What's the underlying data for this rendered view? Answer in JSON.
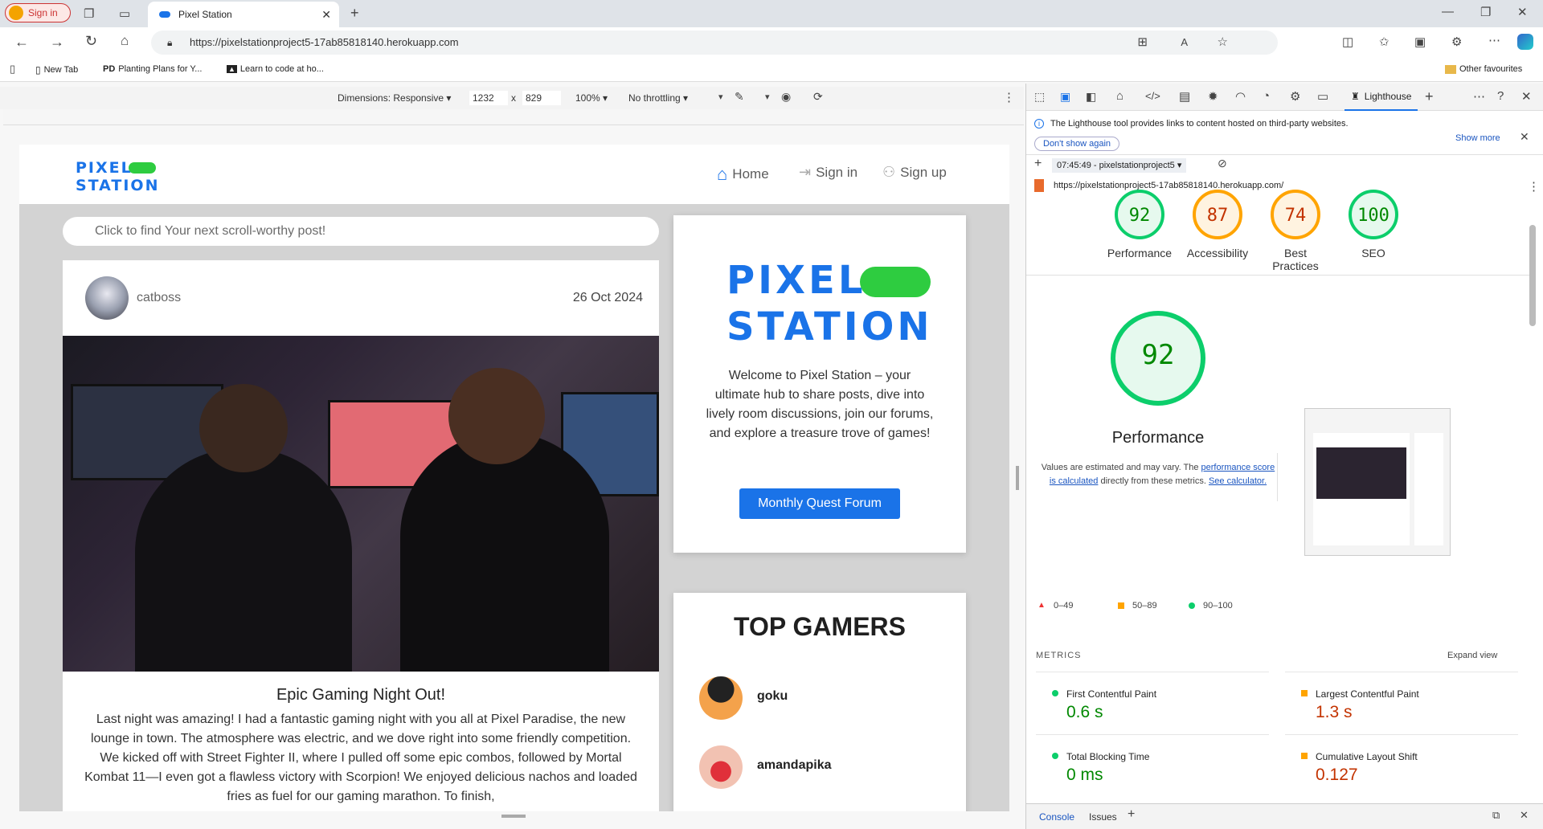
{
  "browser": {
    "profile_label": "Sign in",
    "tab_title": "Pixel Station",
    "url": "https://pixelstationproject5-17ab85818140.herokuapp.com",
    "bookmarks": [
      "New Tab",
      "Planting Plans for Y...",
      "Learn to code at ho..."
    ],
    "other_favourites": "Other favourites"
  },
  "device_toolbar": {
    "dimensions": "Dimensions: Responsive",
    "width": "1232",
    "height": "829",
    "zoom": "100%",
    "throttling": "No throttling",
    "times": "x"
  },
  "site": {
    "logo_line1": "PIXEL",
    "logo_line2": "STATION",
    "nav": [
      "Home",
      "Sign in",
      "Sign up"
    ],
    "search_placeholder": "Click to find Your next scroll-worthy post!",
    "post": {
      "author": "catboss",
      "date": "26 Oct 2024",
      "title": "Epic Gaming Night Out!",
      "body": "Last night was amazing! I had a fantastic gaming night with you all at Pixel Paradise, the new lounge in town. The atmosphere was electric, and we dove right into some friendly competition. We kicked off with Street Fighter II, where I pulled off some epic combos, followed by Mortal Kombat 11—I even got a flawless victory with Scorpion! We enjoyed delicious nachos and loaded fries as fuel for our gaming marathon. To finish,"
    },
    "welcome": {
      "logo_line1": "PIXEL",
      "logo_line2": "STATION",
      "text": "Welcome to Pixel Station – your ultimate hub to share posts, dive into lively room discussions, join our forums, and explore a treasure trove of games!",
      "button": "Monthly Quest Forum"
    },
    "top_gamers": {
      "heading": "TOP GAMERS",
      "users": [
        "goku",
        "amandapika"
      ]
    }
  },
  "lighthouse": {
    "tab_label": "Lighthouse",
    "notice": "The Lighthouse tool provides links to content hosted on third-party websites.",
    "dont_show": "Don't show again",
    "show_more": "Show more",
    "report_select": "07:45:49 - pixelstationproject5",
    "report_url": "https://pixelstationproject5-17ab85818140.herokuapp.com/",
    "scores": [
      {
        "value": "92",
        "label": "Performance",
        "color": "#0cce6b"
      },
      {
        "value": "87",
        "label": "Accessibility",
        "color": "#ffa400"
      },
      {
        "value": "74",
        "label": "Best Practices",
        "color": "#ffa400"
      },
      {
        "value": "100",
        "label": "SEO",
        "color": "#0cce6b"
      }
    ],
    "perf_score": "92",
    "perf_label": "Performance",
    "perf_note_1": "Values are estimated and may vary. The",
    "perf_link": "performance score is calculated",
    "perf_note_2": "directly from these metrics.",
    "calc_link": "See calculator.",
    "legend": [
      "0–49",
      "50–89",
      "90–100"
    ],
    "metrics_title": "METRICS",
    "expand_view": "Expand view",
    "metrics": [
      {
        "label": "First Contentful Paint",
        "value": "0.6 s",
        "color": "#0cce6b",
        "value_color": "#008800"
      },
      {
        "label": "Largest Contentful Paint",
        "value": "1.3 s",
        "color": "#ffa400",
        "value_color": "#c33300"
      },
      {
        "label": "Total Blocking Time",
        "value": "0 ms",
        "color": "#0cce6b",
        "value_color": "#008800"
      },
      {
        "label": "Cumulative Layout Shift",
        "value": "0.127",
        "color": "#ffa400",
        "value_color": "#c33300"
      }
    ],
    "drawer_tabs": [
      "Console",
      "Issues"
    ]
  }
}
